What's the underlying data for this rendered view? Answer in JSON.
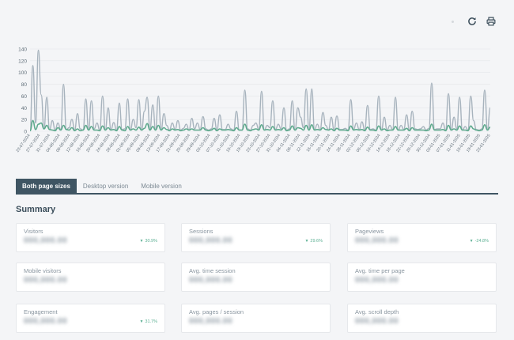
{
  "toolbar": {
    "refresh_icon": "refresh-icon",
    "print_icon": "print-icon"
  },
  "chart_data": {
    "type": "line",
    "ylim": [
      0,
      140
    ],
    "yticks": [
      0,
      20,
      40,
      60,
      80,
      100,
      120,
      140
    ],
    "grid": true,
    "colors": {
      "series_a": "#a7b3bd",
      "series_b": "#5eaa8d"
    },
    "x_labels": [
      "23-07-2024",
      "27-07-2024",
      "31-07-2024",
      "04-08-2024",
      "08-08-2024",
      "12-08-2024",
      "16-08-2024",
      "20-08-2024",
      "24-08-2024",
      "28-08-2024",
      "01-09-2024",
      "05-09-2024",
      "09-09-2024",
      "13-09-2024",
      "17-09-2024",
      "21-09-2024",
      "25-09-2024",
      "29-09-2024",
      "03-10-2024",
      "07-10-2024",
      "11-10-2024",
      "15-10-2024",
      "19-10-2024",
      "23-10-2024",
      "27-10-2024",
      "31-10-2024",
      "04-11-2024",
      "08-11-2024",
      "12-11-2024",
      "16-11-2024",
      "20-11-2024",
      "24-11-2024",
      "28-11-2024",
      "02-12-2024",
      "06-12-2024",
      "10-12-2024",
      "14-12-2024",
      "18-12-2024",
      "22-12-2024",
      "26-12-2024",
      "30-12-2024",
      "03-01-2025",
      "07-01-2025",
      "11-01-2025",
      "15-01-2025",
      "19-01-2025",
      "23-01-2025"
    ],
    "series": [
      {
        "values": [
          2,
          112,
          14,
          138,
          62,
          4,
          58,
          3,
          18,
          2,
          14,
          3,
          80,
          3,
          6,
          20,
          2,
          30,
          4,
          2,
          55,
          2,
          52,
          4,
          14,
          2,
          60,
          2,
          40,
          3,
          15,
          2,
          48,
          3,
          4,
          55,
          2,
          20,
          6,
          54,
          2,
          34,
          58,
          3,
          45,
          2,
          60,
          2,
          30,
          10,
          2,
          14,
          3,
          18,
          2,
          5,
          12,
          2,
          22,
          4,
          14,
          3,
          25,
          4,
          2,
          4,
          22,
          2,
          28,
          3,
          3,
          12,
          4,
          2,
          34,
          2,
          2,
          70,
          4,
          2,
          10,
          14,
          3,
          68,
          2,
          10,
          6,
          52,
          3,
          12,
          4,
          40,
          2,
          4,
          52,
          2,
          40,
          24,
          6,
          72,
          2,
          72,
          3,
          12,
          2,
          32,
          10,
          2,
          24,
          2,
          26,
          3,
          3,
          5,
          2,
          54,
          3,
          14,
          3,
          16,
          2,
          44,
          3,
          4,
          2,
          60,
          2,
          24,
          2,
          10,
          3,
          58,
          2,
          10,
          3,
          28,
          2,
          34,
          4,
          3,
          4,
          8,
          2,
          5,
          82,
          3,
          4,
          4,
          14,
          2,
          64,
          2,
          24,
          4,
          58,
          2,
          8,
          2,
          60,
          18,
          3,
          2,
          4,
          70,
          3,
          40
        ]
      },
      {
        "values": [
          1,
          18,
          3,
          12,
          14,
          4,
          10,
          3,
          2,
          1,
          6,
          2,
          10,
          3,
          2,
          6,
          1,
          4,
          1,
          2,
          10,
          2,
          8,
          2,
          2,
          1,
          9,
          2,
          6,
          2,
          3,
          1,
          8,
          2,
          1,
          8,
          2,
          4,
          2,
          7,
          2,
          5,
          13,
          2,
          8,
          2,
          10,
          2,
          6,
          3,
          1,
          4,
          2,
          3,
          1,
          2,
          4,
          2,
          4,
          2,
          2,
          2,
          6,
          2,
          1,
          2,
          5,
          1,
          4,
          2,
          2,
          3,
          2,
          1,
          6,
          2,
          2,
          12,
          2,
          1,
          3,
          4,
          2,
          11,
          2,
          3,
          2,
          8,
          2,
          3,
          2,
          6,
          1,
          2,
          9,
          2,
          6,
          5,
          2,
          10,
          2,
          11,
          2,
          3,
          2,
          6,
          3,
          2,
          4,
          1,
          5,
          2,
          2,
          2,
          1,
          9,
          2,
          3,
          2,
          3,
          1,
          7,
          2,
          2,
          1,
          9,
          2,
          4,
          1,
          2,
          2,
          8,
          2,
          2,
          2,
          5,
          1,
          6,
          2,
          2,
          2,
          2,
          1,
          2,
          12,
          2,
          2,
          2,
          3,
          1,
          10,
          2,
          4,
          2,
          9,
          2,
          2,
          1,
          9,
          4,
          2,
          1,
          2,
          11,
          2,
          7
        ]
      }
    ]
  },
  "tabs": [
    {
      "label": "Both page sizes",
      "active": true
    },
    {
      "label": "Desktop version",
      "active": false
    },
    {
      "label": "Mobile version",
      "active": false
    }
  ],
  "summary": {
    "title": "Summary",
    "cards": [
      {
        "label": "Visitors",
        "value": "000,000.00",
        "delta": "30.9%",
        "direction": "up"
      },
      {
        "label": "Sessions",
        "value": "000,000.00",
        "delta": "29.6%",
        "direction": "up"
      },
      {
        "label": "Pageviews",
        "value": "000,000.00",
        "delta": "-24.8%",
        "direction": "down"
      },
      {
        "label": "Mobile visitors",
        "value": "000,000.00",
        "delta": "",
        "direction": ""
      },
      {
        "label": "Avg. time session",
        "value": "000,000.00",
        "delta": "",
        "direction": ""
      },
      {
        "label": "Avg. time per page",
        "value": "000,000.00",
        "delta": "",
        "direction": ""
      },
      {
        "label": "Engagement",
        "value": "000,000.00",
        "delta": "31.7%",
        "direction": "up"
      },
      {
        "label": "Avg. pages / session",
        "value": "000,000.00",
        "delta": "",
        "direction": ""
      },
      {
        "label": "Avg. scroll depth",
        "value": "000,000.00",
        "delta": "",
        "direction": ""
      }
    ]
  }
}
